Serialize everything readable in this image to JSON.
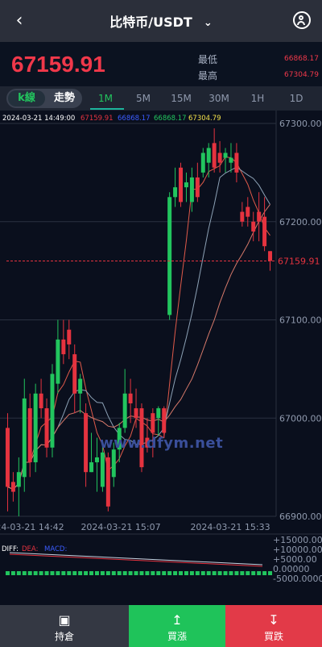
{
  "header": {
    "title": "比特币/USDT",
    "back_icon": "chevron-left-icon",
    "user_icon": "user-icon"
  },
  "price": "67159.91",
  "stats": {
    "low_label": "最低",
    "low_value": "66868.17",
    "high_label": "最高",
    "high_value": "67304.79"
  },
  "tabs": {
    "kline": "k線",
    "trend": "走勢",
    "timeframes": [
      "1M",
      "5M",
      "15M",
      "30M",
      "1H",
      "1D"
    ],
    "active": "1M"
  },
  "ohlc": {
    "time": "2024-03-21 14:49:00",
    "open": "67159.91",
    "high": "66868.17",
    "low": "66868.17",
    "close": "67304.79"
  },
  "chart_data": {
    "type": "candlestick",
    "ylim": [
      66900,
      67300
    ],
    "yticks": [
      "67300.00",
      "67200.00",
      "67100.00",
      "67000.00",
      "66900.00"
    ],
    "current_price": "67159.91",
    "xticks": [
      "2024-03-21 14:42",
      "2024-03-21 15:07",
      "2024-03-21 15:33"
    ],
    "candles": [
      {
        "o": 66990,
        "c": 66930,
        "h": 67005,
        "l": 66905
      },
      {
        "o": 66935,
        "c": 66925,
        "h": 66945,
        "l": 66915
      },
      {
        "o": 66930,
        "c": 66945,
        "h": 66960,
        "l": 66900
      },
      {
        "o": 66940,
        "c": 67020,
        "h": 67040,
        "l": 66925
      },
      {
        "o": 67010,
        "c": 66955,
        "h": 67025,
        "l": 66940
      },
      {
        "o": 66955,
        "c": 67025,
        "h": 67035,
        "l": 66945
      },
      {
        "o": 67025,
        "c": 67010,
        "h": 67040,
        "l": 67000
      },
      {
        "o": 67010,
        "c": 66970,
        "h": 67020,
        "l": 66960
      },
      {
        "o": 66970,
        "c": 67045,
        "h": 67055,
        "l": 66960
      },
      {
        "o": 67035,
        "c": 67080,
        "h": 67100,
        "l": 67025
      },
      {
        "o": 67080,
        "c": 67065,
        "h": 67100,
        "l": 67055
      },
      {
        "o": 67090,
        "c": 67075,
        "h": 67100,
        "l": 67060
      },
      {
        "o": 67065,
        "c": 67025,
        "h": 67075,
        "l": 67005
      },
      {
        "o": 67025,
        "c": 67040,
        "h": 67045,
        "l": 67005
      },
      {
        "o": 67005,
        "c": 66945,
        "h": 67015,
        "l": 66930
      },
      {
        "o": 66945,
        "c": 66955,
        "h": 66985,
        "l": 66945
      },
      {
        "o": 66955,
        "c": 66960,
        "h": 66980,
        "l": 66925
      },
      {
        "o": 66930,
        "c": 66965,
        "h": 66975,
        "l": 66925
      },
      {
        "o": 66960,
        "c": 66910,
        "h": 66965,
        "l": 66905
      },
      {
        "o": 66940,
        "c": 66968,
        "h": 66975,
        "l": 66930
      },
      {
        "o": 66968,
        "c": 66990,
        "h": 66995,
        "l": 66955
      },
      {
        "o": 66990,
        "c": 67025,
        "h": 67050,
        "l": 66985
      },
      {
        "o": 67025,
        "c": 67015,
        "h": 67040,
        "l": 66995
      },
      {
        "o": 67010,
        "c": 67000,
        "h": 67030,
        "l": 66990
      },
      {
        "o": 67010,
        "c": 66950,
        "h": 67015,
        "l": 66945
      },
      {
        "o": 66980,
        "c": 66970,
        "h": 67000,
        "l": 66965
      },
      {
        "o": 67005,
        "c": 66985,
        "h": 67010,
        "l": 66960
      },
      {
        "o": 67000,
        "c": 67010,
        "h": 67012,
        "l": 66982
      },
      {
        "o": 67010,
        "c": 66985,
        "h": 67012,
        "l": 66980
      },
      {
        "o": 67105,
        "c": 67225,
        "h": 67230,
        "l": 67100
      },
      {
        "o": 67225,
        "c": 67235,
        "h": 67255,
        "l": 67215
      },
      {
        "o": 67255,
        "c": 67220,
        "h": 67260,
        "l": 67215
      },
      {
        "o": 67235,
        "c": 67240,
        "h": 67250,
        "l": 67220
      },
      {
        "o": 67220,
        "c": 67245,
        "h": 67255,
        "l": 67210
      },
      {
        "o": 67245,
        "c": 67225,
        "h": 67260,
        "l": 67220
      },
      {
        "o": 67250,
        "c": 67270,
        "h": 67275,
        "l": 67245
      },
      {
        "o": 67260,
        "c": 67275,
        "h": 67280,
        "l": 67245
      },
      {
        "o": 67280,
        "c": 67255,
        "h": 67295,
        "l": 67250
      },
      {
        "o": 67270,
        "c": 67260,
        "h": 67282,
        "l": 67250
      },
      {
        "o": 67265,
        "c": 67270,
        "h": 67275,
        "l": 67250
      },
      {
        "o": 67260,
        "c": 67265,
        "h": 67280,
        "l": 67250
      },
      {
        "o": 67270,
        "c": 67250,
        "h": 67280,
        "l": 67240
      },
      {
        "o": 67210,
        "c": 67200,
        "h": 67220,
        "l": 67195
      },
      {
        "o": 67215,
        "c": 67205,
        "h": 67225,
        "l": 67195
      },
      {
        "o": 67200,
        "c": 67190,
        "h": 67210,
        "l": 67180
      },
      {
        "o": 67210,
        "c": 67200,
        "h": 67230,
        "l": 67180
      },
      {
        "o": 67205,
        "c": 67175,
        "h": 67225,
        "l": 67170
      },
      {
        "o": 67170,
        "c": 67160,
        "h": 67170,
        "l": 67150
      }
    ],
    "macd_labels": [
      "DIFF:",
      "DEA:",
      "MACD:"
    ],
    "macd_yticks": [
      "+15000.00",
      "+10000.00",
      "+5000.00",
      "0.00000",
      "-5000.0000"
    ]
  },
  "watermark": "www.dfym.net",
  "footer": {
    "hold": {
      "label": "持倉",
      "icon": "briefcase-icon"
    },
    "buy": {
      "label": "買漲",
      "icon": "upload-icon"
    },
    "sell": {
      "label": "買跌",
      "icon": "download-icon"
    }
  },
  "colors": {
    "up": "#22c55e",
    "down": "#e5333f",
    "header": "#2b2f3a",
    "tabs": "#1f2532"
  }
}
